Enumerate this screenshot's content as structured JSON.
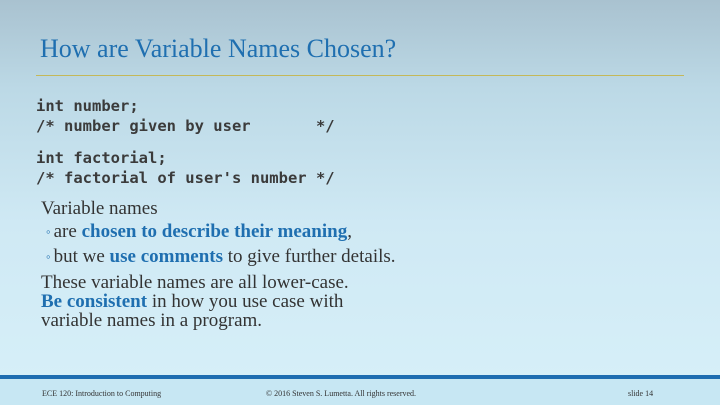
{
  "slide": {
    "title": "How are Variable Names Chosen?",
    "code_block_1": [
      "int number;",
      "/* number given by user       */"
    ],
    "code_block_2": [
      "int factorial;",
      "/* factorial of user's number */"
    ],
    "paragraph_1": "Variable names",
    "bullets": [
      {
        "marker": "◦",
        "pre": "are ",
        "highlight": "chosen to describe their meaning",
        "post": ","
      },
      {
        "marker": "◦",
        "pre": "but we ",
        "highlight": "use comments",
        "post": " to give further details."
      }
    ],
    "paragraph_2_line_1": "These variable names are all lower-case.",
    "paragraph_2_highlight": "Be consistent",
    "paragraph_2_line_2_rest": " in how you use case with",
    "paragraph_2_line_3": "variable names in a program."
  },
  "footer": {
    "course": "ECE 120: Introduction to Computing",
    "copyright": "© 2016 Steven S. Lumetta.  All rights reserved.",
    "slide_number": "slide 14"
  },
  "colors": {
    "accent_blue": "#1f6fb0",
    "title_rule": "#c4b85a",
    "footer_bar": "#1e6db1"
  }
}
